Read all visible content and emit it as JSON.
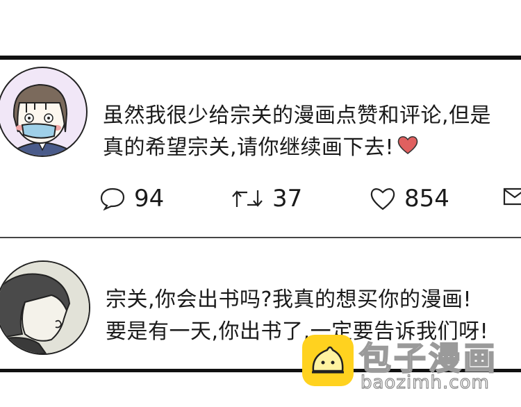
{
  "comments": [
    {
      "text_lines": [
        "虽然我很少给宗关的漫画点赞和评论,但是",
        "真的希望宗关,请你继续画下去!"
      ],
      "actions": {
        "replies": "94",
        "retweets": "37",
        "likes": "854"
      }
    },
    {
      "text_lines": [
        "宗关,你会出书吗?我真的想买你的漫画!",
        "要是有一天,你出书了,一定要告诉我们呀!"
      ]
    }
  ],
  "watermark": {
    "title": "包子漫画",
    "url": "baozimh.com"
  },
  "colors": {
    "heart": "#e0605f",
    "logo": "#ffd21f",
    "avatar1_bg": "#f1e7f7",
    "mask": "#9fd0e8"
  }
}
